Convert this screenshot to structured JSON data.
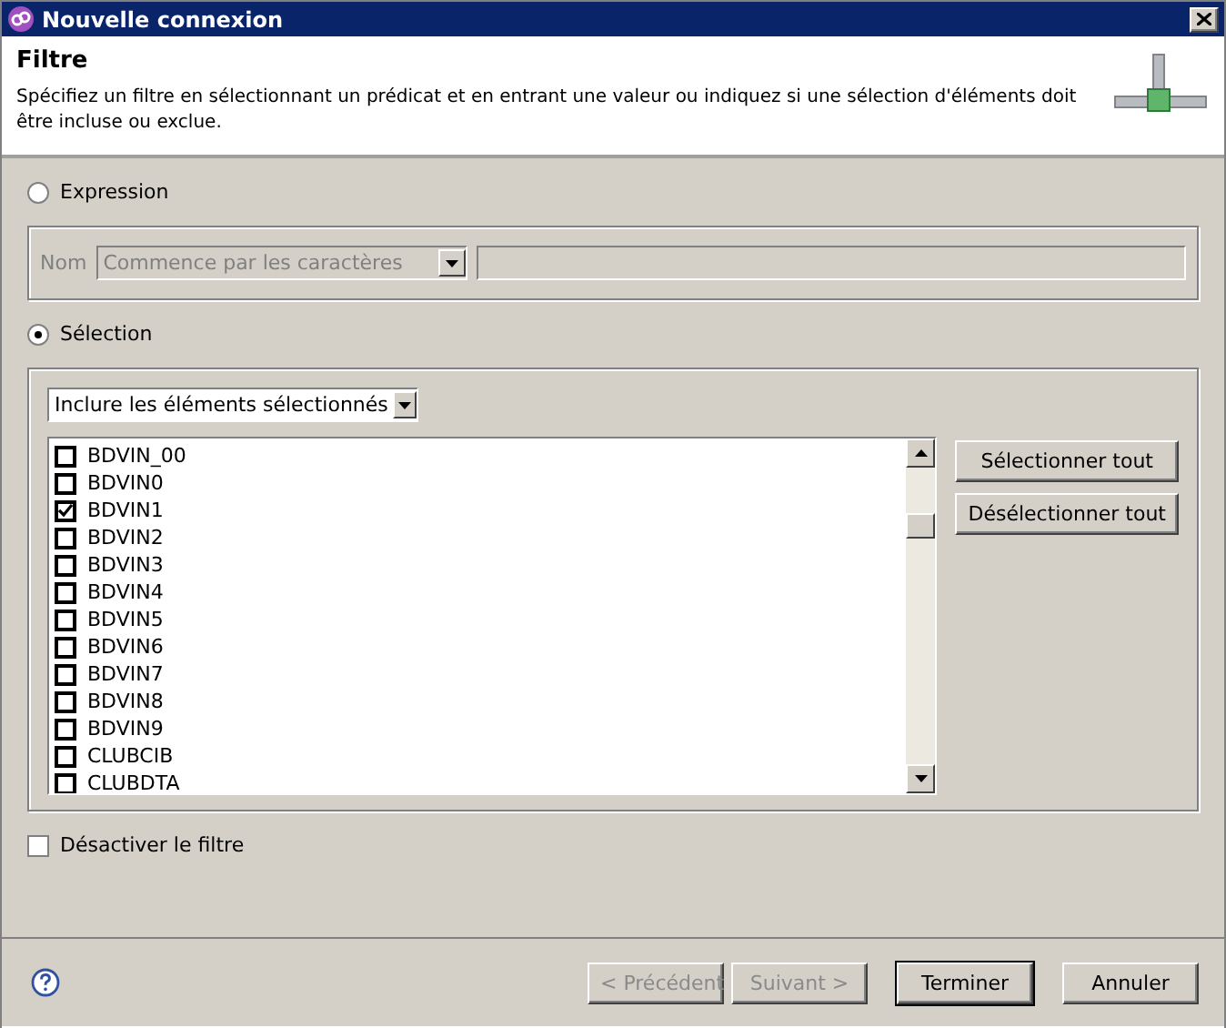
{
  "window": {
    "title": "Nouvelle connexion"
  },
  "header": {
    "title": "Filtre",
    "description": "Spécifiez un filtre en sélectionnant un prédicat et en entrant une valeur ou indiquez si une sélection d'éléments doit être incluse ou exclue."
  },
  "modes": [
    {
      "label": "Expression",
      "selected": false
    },
    {
      "label": "Sélection",
      "selected": true
    }
  ],
  "expression": {
    "disabled": true,
    "name_label": "Nom",
    "predicate": "Commence par les caractères"
  },
  "selection": {
    "mode": "Inclure les éléments sélectionnés",
    "items": [
      {
        "label": "BDVIN_00",
        "checked": false
      },
      {
        "label": "BDVIN0",
        "checked": false
      },
      {
        "label": "BDVIN1",
        "checked": true
      },
      {
        "label": "BDVIN2",
        "checked": false
      },
      {
        "label": "BDVIN3",
        "checked": false
      },
      {
        "label": "BDVIN4",
        "checked": false
      },
      {
        "label": "BDVIN5",
        "checked": false
      },
      {
        "label": "BDVIN6",
        "checked": false
      },
      {
        "label": "BDVIN7",
        "checked": false
      },
      {
        "label": "BDVIN8",
        "checked": false
      },
      {
        "label": "BDVIN9",
        "checked": false
      },
      {
        "label": "CLUBCIB",
        "checked": false
      },
      {
        "label": "CLUBDTA",
        "checked": false
      }
    ],
    "buttons": [
      "Sélectionner tout",
      "Désélectionner tout"
    ]
  },
  "disable_filter": {
    "label": "Désactiver le filtre",
    "checked": false
  },
  "footer_buttons": [
    {
      "label": "< Précédent",
      "disabled": true,
      "default": false
    },
    {
      "label": "Suivant >",
      "disabled": true,
      "default": false
    },
    {
      "label": "Terminer",
      "disabled": false,
      "default": true
    },
    {
      "label": "Annuler",
      "disabled": false,
      "default": false
    }
  ]
}
